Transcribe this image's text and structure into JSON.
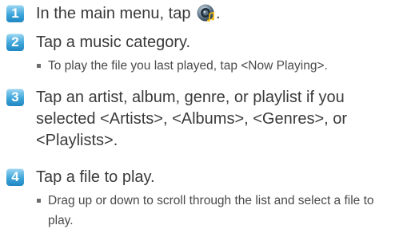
{
  "steps": [
    {
      "number": "1",
      "text": "In the main menu, tap",
      "suffix": ".",
      "icon": "music-player-icon",
      "sub": []
    },
    {
      "number": "2",
      "text": "Tap a music category.",
      "sub": [
        "To play the file you last played, tap <Now Playing>."
      ]
    },
    {
      "number": "3",
      "text": "Tap an artist, album, genre, or playlist if you selected <Artists>, <Albums>, <Genres>, or <Playlists>.",
      "sub": []
    },
    {
      "number": "4",
      "text": "Tap a file to play.",
      "sub": [
        "Drag up or down to scroll through the list and select a file to play."
      ]
    }
  ],
  "colors": {
    "badge": "#3fa6da",
    "text": "#3a3a3a"
  }
}
